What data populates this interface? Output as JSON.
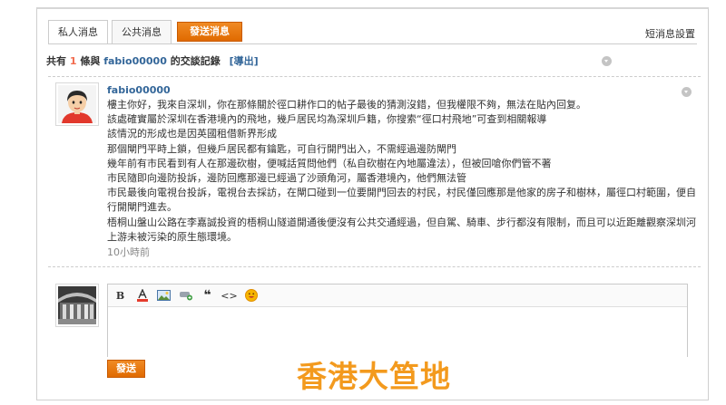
{
  "tabs": {
    "private": "私人消息",
    "public": "公共消息",
    "send": "發送消息"
  },
  "settings_link": "短消息設置",
  "summary": {
    "prefix": "共有",
    "count": "1",
    "middle": "條與",
    "username": "fabio00000",
    "suffix": "的交談記錄",
    "export": "[導出]"
  },
  "message": {
    "username": "fabio00000",
    "lines": [
      "樓主你好，我來自深圳，你在那條關於徑口耕作口的帖子最後的猜測沒錯，但我權限不夠，無法在貼內回复。",
      "該處確實屬於深圳在香港境內的飛地，幾戶居民均為深圳戶籍，你搜索“徑口村飛地”可查到相關報導",
      "該情況的形成也是因英國租借新界形成",
      "那個閘門平時上鎖，但幾戶居民都有鑰匙，可自行開門出入，不需經過邊防閘門",
      "幾年前有市民看到有人在那邊砍樹，便喊話質問他們（私自砍樹在內地屬違法），但被回嗆你們管不著",
      "市民隨即向邊防投訴，邊防回應那邊已經過了沙頭角河，屬香港境內，他們無法管",
      "市民最後向電視台投訴，電視台去採訪，在閘口碰到一位要開門回去的村民，村民僅回應那是他家的房子和樹林，屬徑口村範圍，便自",
      "行開閘門進去。",
      "梧桐山盤山公路在李嘉誠投資的梧桐山隧道開通後便沒有公共交通經過，但自駕、騎車、步行都沒有限制，而且可以近距離觀察深圳河",
      "上游未被污染的原生態環境。"
    ],
    "time": "10小時前"
  },
  "reply": {
    "send_label": "發送",
    "toolbar_icons": [
      "bold-icon",
      "font-color-icon",
      "image-icon",
      "link-icon",
      "quote-icon",
      "code-icon",
      "smiley-icon"
    ]
  },
  "watermark": "香港大笪地",
  "colors": {
    "accent_orange": "#e87511",
    "link_blue": "#336699",
    "count_red": "#f26c4f"
  }
}
